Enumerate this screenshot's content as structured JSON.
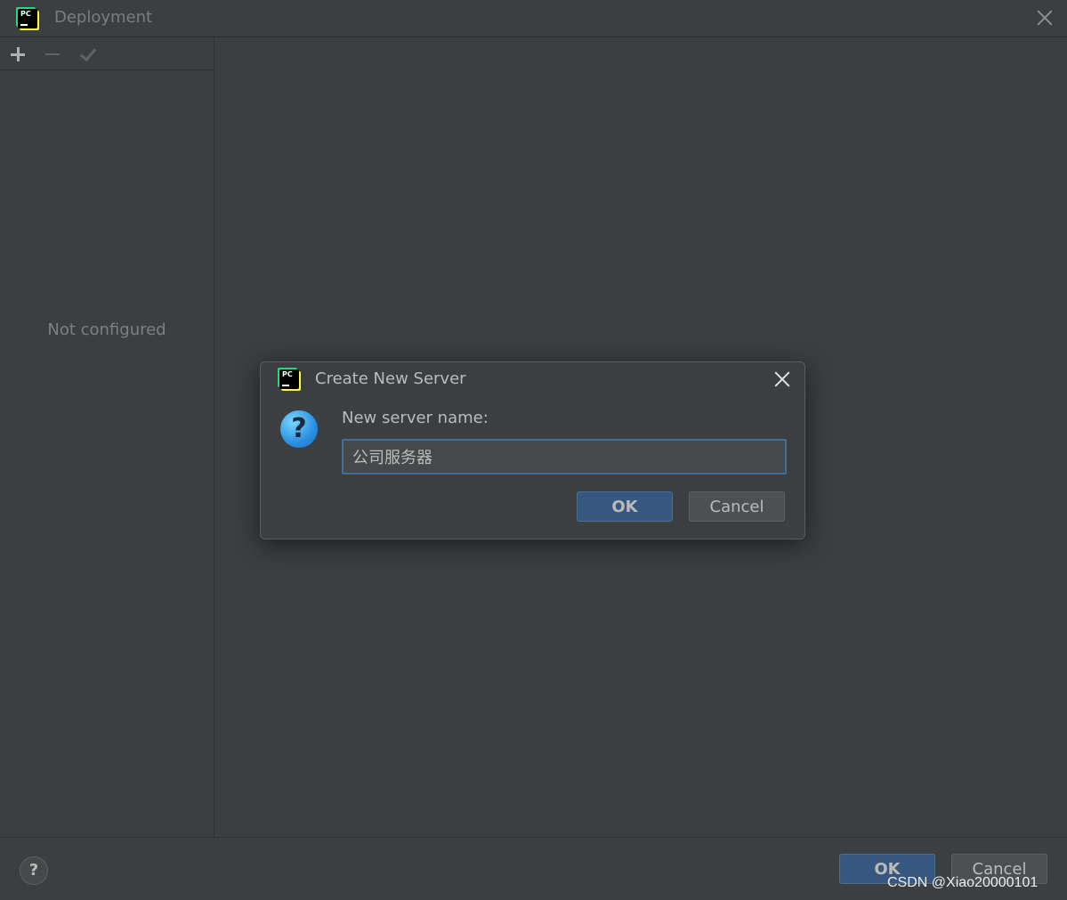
{
  "window": {
    "title": "Deployment",
    "app_icon_text": "PC"
  },
  "sidebar": {
    "empty_text": "Not configured",
    "toolbar": {
      "add": "+",
      "remove": "−",
      "apply": "✓"
    }
  },
  "footer": {
    "help_label": "?",
    "ok_label": "OK",
    "cancel_label": "Cancel"
  },
  "dialog": {
    "title": "Create New Server",
    "app_icon_text": "PC",
    "question_icon": "?",
    "prompt": "New server name:",
    "input_value": "公司服务器",
    "ok_label": "OK",
    "cancel_label": "Cancel"
  },
  "watermark": "CSDN @Xiao20000101",
  "colors": {
    "background": "#3c3f41",
    "primary_button": "#365880",
    "input_focus_border": "#466d94"
  }
}
